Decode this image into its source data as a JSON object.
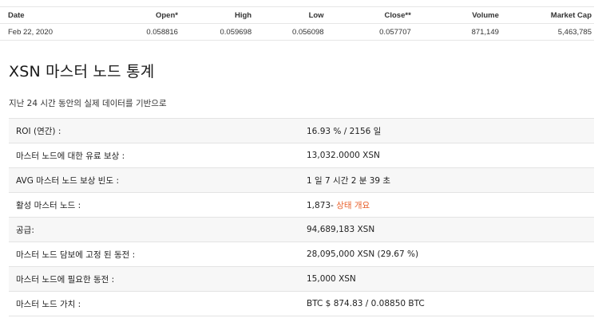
{
  "price_table": {
    "headers": [
      "Date",
      "Open*",
      "High",
      "Low",
      "Close**",
      "Volume",
      "Market Cap"
    ],
    "rows": [
      [
        "Feb 22, 2020",
        "0.058816",
        "0.059698",
        "0.056098",
        "0.057707",
        "871,149",
        "5,463,785"
      ]
    ]
  },
  "masternode": {
    "title": "XSN 마스터 노드 통계",
    "subtitle": "지난 24 시간 동안의 실제 데이터를 기반으로",
    "stats": [
      {
        "label": "ROI (연간) :",
        "value": "16.93 % / 2156 일"
      },
      {
        "label": "마스터 노드에 대한 유료 보상 :",
        "value": "13,032.0000 XSN"
      },
      {
        "label": "AVG 마스터 노드 보상 빈도 :",
        "value": "1 일 7 시간 2 분 39 초"
      },
      {
        "label": "활성 마스터 노드 :",
        "value": "1,873- ",
        "link": "상태 개요"
      },
      {
        "label": "공급:",
        "value": "94,689,183 XSN"
      },
      {
        "label": "마스터 노드 담보에 고정 된 동전 :",
        "value": "28,095,000 XSN (29.67 %)"
      },
      {
        "label": "마스터 노드에 필요한 동전 :",
        "value": "15,000 XSN"
      },
      {
        "label": "마스터 노드 가치 :",
        "value": "BTC $ 874.83 / 0.08850 BTC"
      }
    ]
  },
  "colors": {
    "link": "#e8612c",
    "row_alt": "#f7f7f7",
    "border": "#e3e3e3"
  }
}
